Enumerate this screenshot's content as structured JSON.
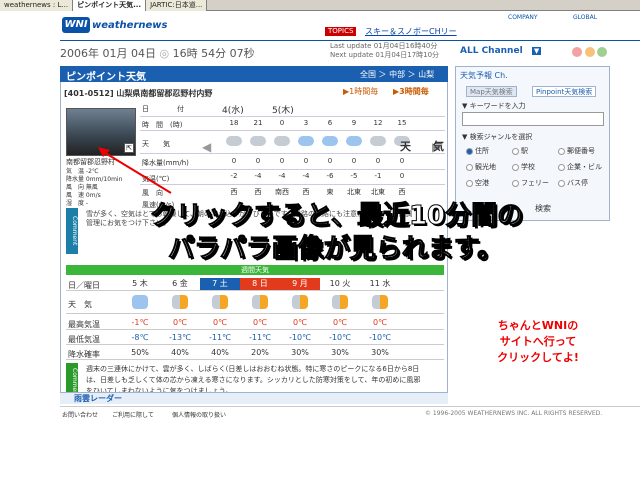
{
  "browser_tabs": [
    "weathernews : L...",
    "ピンポイント天気...",
    "JARTIC:日本道..."
  ],
  "header": {
    "logo": "WNI",
    "brand": "weathernews",
    "topics_badge": "TOPICS",
    "topics_link": "スキー＆スノボーCHリー",
    "company": "COMPANY",
    "global": "GLOBAL",
    "date": "2006年 01月 04日",
    "time": "16時 54分 07秒",
    "last_update": "Last update 01月04日16時40分",
    "next_update": "Next update 01月04日17時10分",
    "all_channel": "ALL Channel"
  },
  "main": {
    "title": "ピンポイント天気",
    "breadcrumb": "全国 ＞ 中部 ＞ 山梨",
    "location": "[401-0512] 山梨県南都留郡忍野村内野",
    "period_1h": "▶1時間毎",
    "period_3h": "▶3時間毎",
    "station_name": "南都留郡忍野村",
    "station_lines": [
      "気　温 -2℃",
      "降水量 0mm/10min",
      "風　向 無風",
      "風　速 0m/s",
      "湿　度 -"
    ],
    "row_labels": [
      "日　　　　付",
      "時　間　(時)",
      "天　　気",
      "降水量(mm/h)",
      "気温(℃)",
      "風　向",
      "風速(m/s)"
    ],
    "days": [
      "4(水)",
      "5(木)"
    ],
    "hours": [
      "18",
      "21",
      "0",
      "3",
      "6",
      "9",
      "12",
      "15"
    ],
    "precip": [
      "0",
      "0",
      "0",
      "0",
      "0",
      "0",
      "0",
      "0"
    ],
    "temps": [
      "-2",
      "-4",
      "-4",
      "-4",
      "-6",
      "-5",
      "-1",
      "0"
    ],
    "winds": [
      "西",
      "西",
      "南西",
      "西",
      "東",
      "北東",
      "北東",
      "西"
    ],
    "comment_label": "Comment",
    "comment": "雪が多く、空気はとても乾燥して、朝の冷え込みがきびしいです。道路の凍結にも注意が必要です。体調管理にお気をつけ下さい。"
  },
  "weekly": {
    "header": "週間天気",
    "date_label": "日／曜日",
    "weather_label": "天　気",
    "max_label": "最高気温",
    "min_label": "最低気温",
    "rain_label": "降水確率",
    "days": [
      "5 木",
      "6 金",
      "7 土",
      "8 日",
      "9 月",
      "10 火",
      "11 水"
    ],
    "max": [
      "-1℃",
      "0℃",
      "0℃",
      "0℃",
      "0℃",
      "0℃",
      "0℃"
    ],
    "min": [
      "-8℃",
      "-13℃",
      "-11℃",
      "-11℃",
      "-10℃",
      "-10℃",
      "-10℃"
    ],
    "rain": [
      "50%",
      "40%",
      "40%",
      "20%",
      "30%",
      "30%",
      "30%"
    ],
    "comment_label": "Comment",
    "comment": "週末の三連休にかけて、雲が多く、しばらく(日差しはおおむね状態。特に寒さのピークになる6日から8日は、日差しも乏しくて体の芯から凍える寒さになります。シッカリとした防寒対策をして、年の初めに風邪をひいてしまわないように気をつけましょう。"
  },
  "radar": "雨雲レーダー",
  "footer": {
    "links": [
      "お問い合わせ",
      "ご利用に際して",
      "個人情報の取り扱い"
    ],
    "copyright": "© 1996-2005 WEATHERNEWS INC. ALL RIGHTS RESERVED."
  },
  "right": {
    "title": "天気予報 Ch.",
    "tabs": [
      "Map天気検索",
      "Pinpoint天気検索"
    ],
    "keyword_label": "▼ キーワードを入力",
    "genre_label": "▼ 検索ジャンルを選択",
    "radios": [
      "住所",
      "駅",
      "郵便番号",
      "観光地",
      "学校",
      "企業・ビル",
      "空港",
      "フェリー",
      "バス停"
    ],
    "search_button": "検索"
  },
  "overlay": {
    "line1": "クリックすると、最近10分間の",
    "line2": "パラパラ画像が見られます。",
    "note": [
      "ちゃんとWNIの",
      "サイトへ行って",
      "クリックしてよ!"
    ]
  },
  "colors": {
    "brand": "#1b5fb0",
    "weekly": "#3bb63b",
    "note": "#e00000"
  }
}
